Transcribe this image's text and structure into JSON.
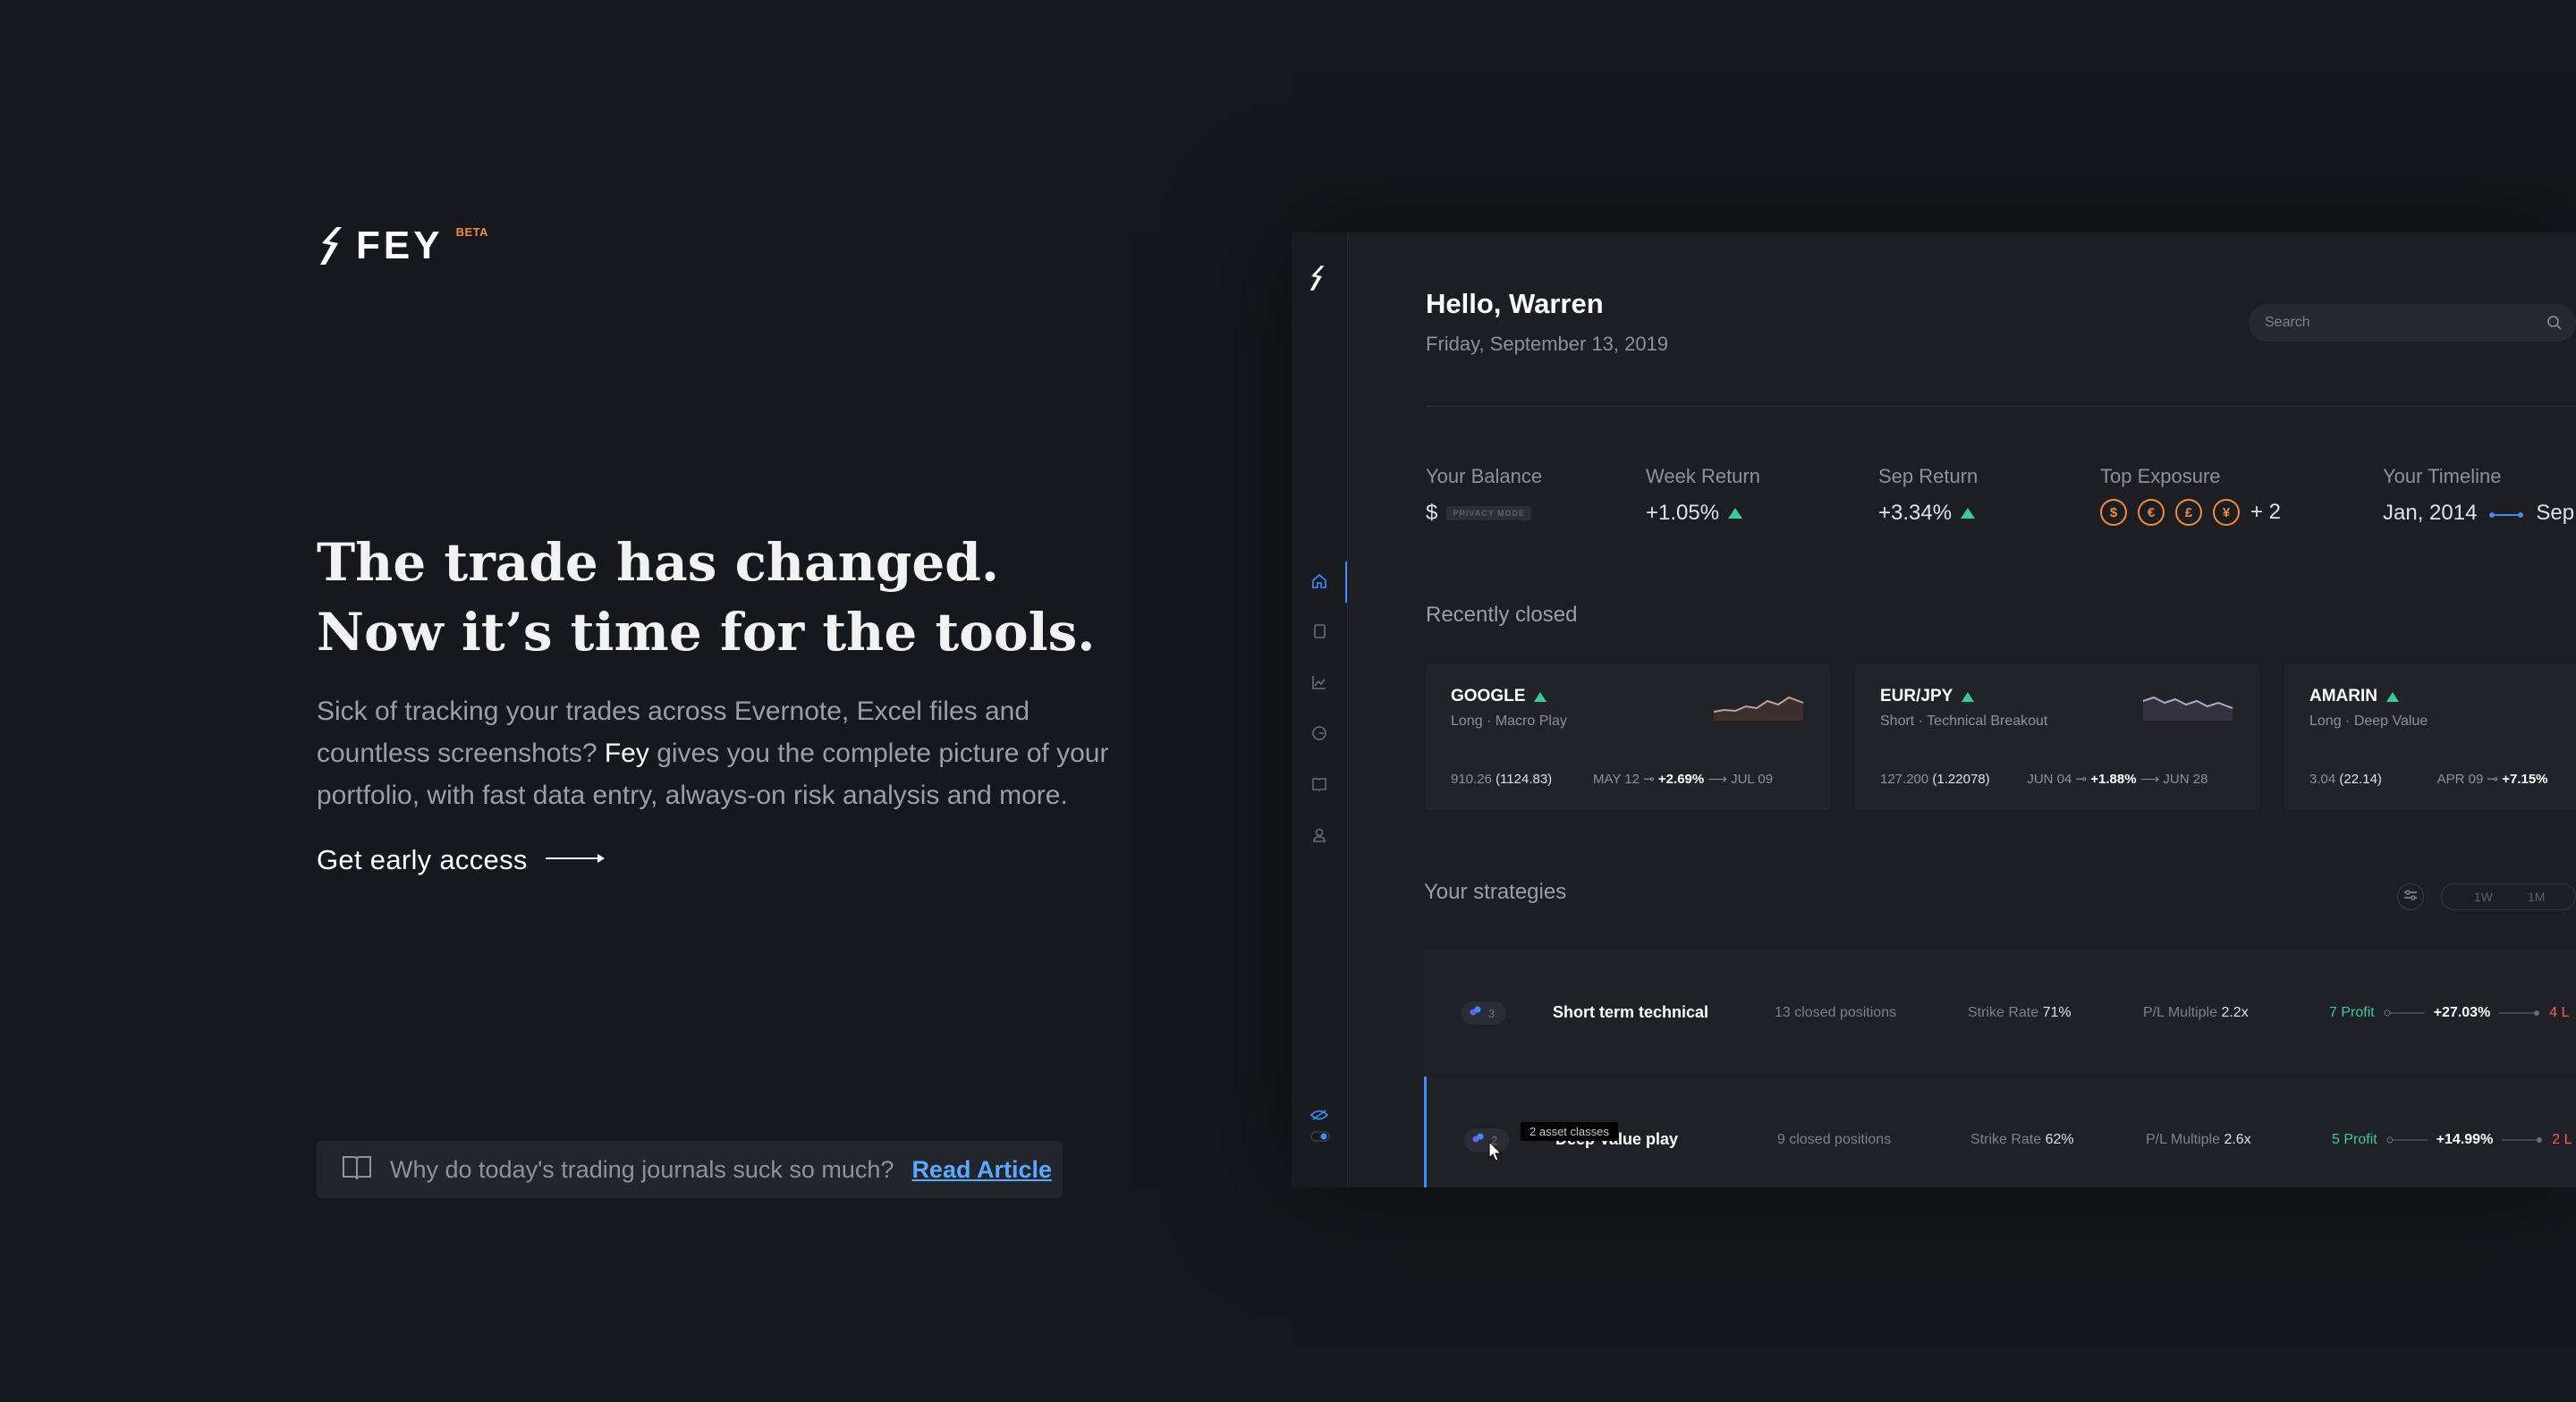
{
  "brand": {
    "name": "FEY",
    "badge": "BETA"
  },
  "hero": {
    "headline_line1": "The trade has changed.",
    "headline_line2": "Now it’s time for the tools.",
    "lead_before": "Sick of tracking your trades across Evernote, Excel files and countless screenshots? ",
    "lead_highlight": "Fey",
    "lead_after": " gives you the complete picture of your portfolio, with fast data entry, always-on risk analysis and more.",
    "cta_label": "Get early access"
  },
  "article": {
    "text": "Why do today's trading journals suck so much?",
    "link": "Read Article"
  },
  "app": {
    "greeting": "Hello, Warren",
    "date": "Friday, September 13, 2019",
    "search_placeholder": "Search",
    "stats": {
      "balance_label": "Your Balance",
      "balance_currency": "$",
      "privacy_badge": "PRIVACY MODE",
      "week_label": "Week Return",
      "week_value": "+1.05%",
      "sep_label": "Sep Return",
      "sep_value": "+3.34%",
      "exposure_label": "Top Exposure",
      "exposure_coins": [
        "$",
        "€",
        "£",
        "¥"
      ],
      "exposure_more": "+ 2",
      "timeline_label": "Your Timeline",
      "timeline_start": "Jan, 2014",
      "timeline_end": "Sep"
    },
    "recently_closed_title": "Recently closed",
    "cards": [
      {
        "ticker": "GOOGLE",
        "sub": "Long · Macro Play",
        "price": "910.26",
        "price2": "(1124.83)",
        "open": "MAY 12",
        "ret": "+2.69%",
        "close": "JUL 09"
      },
      {
        "ticker": "EUR/JPY",
        "sub": "Short · Technical Breakout",
        "price": "127.200",
        "price2": "(1.22078)",
        "open": "JUN 04",
        "ret": "+1.88%",
        "close": "JUN 28"
      },
      {
        "ticker": "AMARIN",
        "sub": "Long · Deep Value",
        "price": "3.04",
        "price2": "(22.14)",
        "open": "APR 09",
        "ret": "+7.15%",
        "close": ""
      }
    ],
    "strategies_title": "Your strategies",
    "range_options": [
      "1W",
      "1M"
    ],
    "strategies": [
      {
        "count": "3",
        "name": "Short term technical",
        "closed": "13 closed positions",
        "strike_label": "Strike Rate",
        "strike": "71%",
        "plm_label": "P/L Multiple",
        "plm": "2.2x",
        "profit": "7 Profit",
        "pct": "+27.03%",
        "loss": "4 L"
      },
      {
        "count": "2",
        "name": "Deep Value play",
        "closed": "9 closed positions",
        "strike_label": "Strike Rate",
        "strike": "62%",
        "plm_label": "P/L Multiple",
        "plm": "2.6x",
        "profit": "5 Profit",
        "pct": "+14.99%",
        "loss": "2 L"
      }
    ],
    "tooltip": "2 asset classes"
  },
  "colors": {
    "accent": "#3f8cff",
    "positive": "#3ec99a",
    "brand_orange": "#f08c3b",
    "negative": "#ff5a5a"
  }
}
